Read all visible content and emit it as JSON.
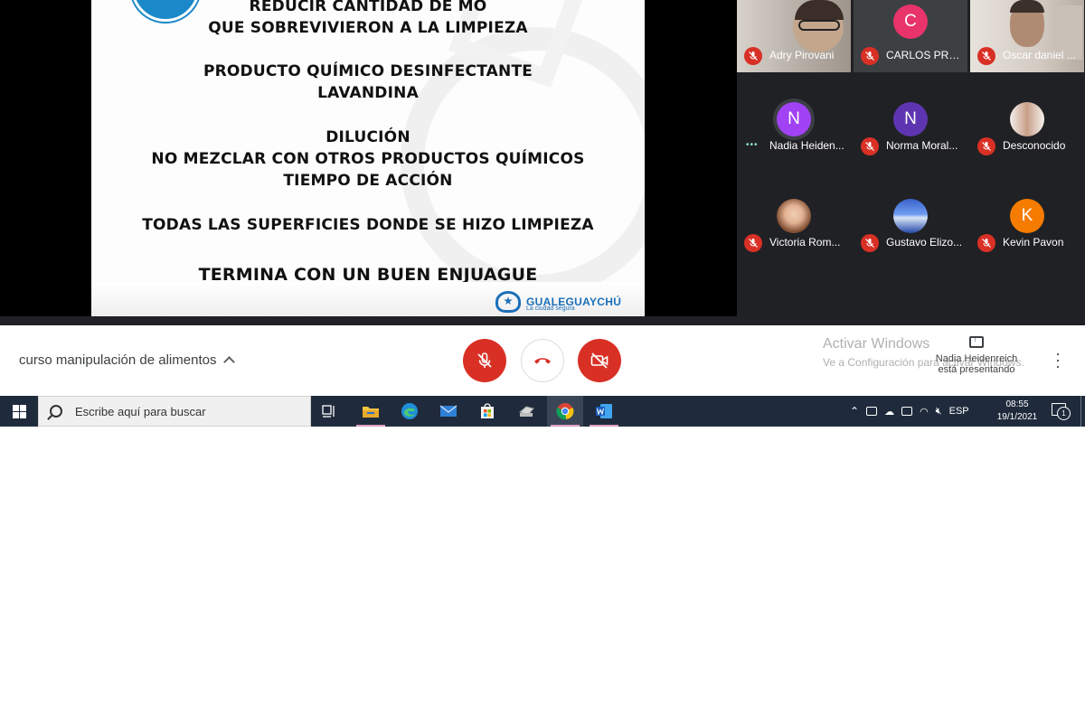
{
  "slide": {
    "lines": [
      "REDUCIR CANTIDAD DE MO",
      "QUE   SOBREVIVIERON  A LA LIMPIEZA",
      "PRODUCTO QUÍMICO DESINFECTANTE",
      "LAVANDINA",
      "DILUCIÓN",
      "NO MEZCLAR CON OTROS PRODUCTOS QUÍMICOS",
      "TIEMPO DE ACCIÓN",
      "TODAS LAS SUPERFICIES DONDE SE HIZO LIMPIEZA",
      "TERMINA CON UN BUEN ENJUAGUE"
    ],
    "brand": "GUALEGUAYCHÚ",
    "brand_tagline": "La ciudad segura"
  },
  "participants": [
    {
      "name": "Adry Pirovani",
      "kind": "camera",
      "muted": true
    },
    {
      "name": "CARLOS PREI...",
      "kind": "avatar",
      "initial": "C",
      "color": "#e8336b",
      "muted": true
    },
    {
      "name": "Oscar daniel ...",
      "kind": "camera",
      "muted": true
    },
    {
      "name": "Nadia Heiden...",
      "kind": "avatar",
      "initial": "N",
      "color": "#a142f4",
      "muted": false,
      "speaking": true
    },
    {
      "name": "Norma Moral...",
      "kind": "avatar",
      "initial": "N",
      "color": "#5e35b1",
      "muted": true
    },
    {
      "name": "Desconocido",
      "kind": "photo",
      "muted": true
    },
    {
      "name": "Victoria Rom...",
      "kind": "photo",
      "muted": true
    },
    {
      "name": "Gustavo Elizo...",
      "kind": "photo",
      "muted": true
    },
    {
      "name": "Kevin Pavon",
      "kind": "avatar",
      "initial": "K",
      "color": "#f57c00",
      "muted": true
    }
  ],
  "meetbar": {
    "title": "curso manipulación de alimentos",
    "activate_line1": "Activar Windows",
    "activate_line2": "Ve a Configuración para activar Windows.",
    "presenter_name": "Nadia Heidenreich",
    "presenter_status": "está presentando"
  },
  "taskbar": {
    "search_placeholder": "Escribe aquí para buscar",
    "lang": "ESP",
    "time": "08:55",
    "date": "19/1/2021",
    "notifications": "1"
  },
  "colors": {
    "meet_bg": "#202124",
    "danger": "#d93025",
    "taskbar": "#1f2b3c"
  }
}
